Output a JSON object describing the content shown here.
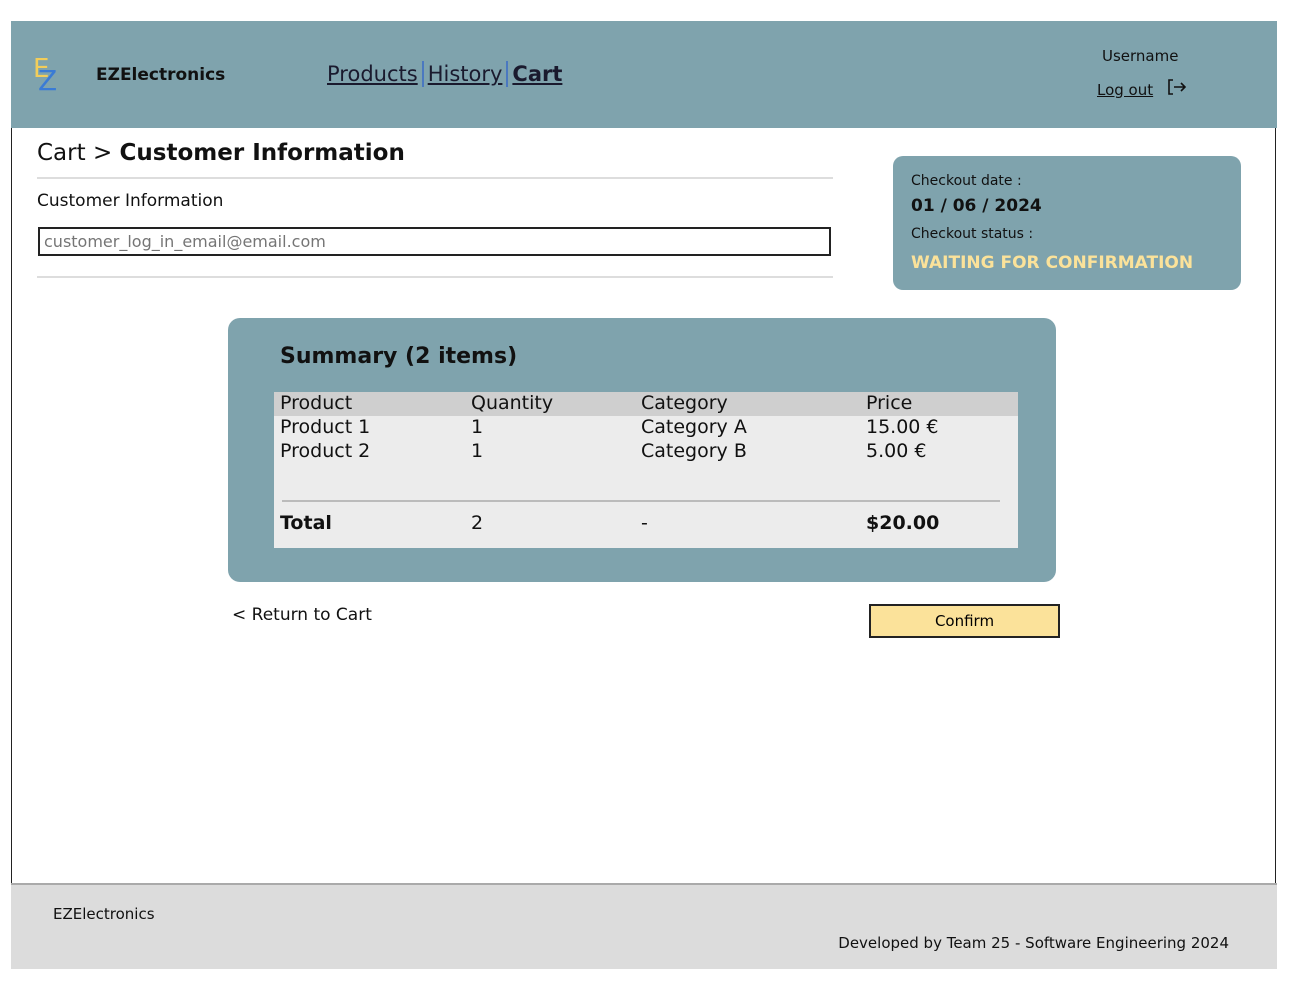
{
  "app": {
    "brand": "EZElectronics",
    "logo_letters": [
      "E",
      "Z"
    ]
  },
  "nav": {
    "products": "Products",
    "history": "History",
    "cart": "Cart"
  },
  "user": {
    "username": "Username",
    "logout": "Log out",
    "logout_icon": "logout-arrow-icon"
  },
  "breadcrumb": {
    "parent": "Cart",
    "separator": ">",
    "current": "Customer Information"
  },
  "customer": {
    "label": "Customer Information",
    "email_placeholder": "customer_log_in_email@email.com",
    "email_value": ""
  },
  "checkout": {
    "date_label": "Checkout date :",
    "date": "01 / 06 / 2024",
    "status_label": "Checkout status :",
    "status": "WAITING FOR CONFIRMATION"
  },
  "summary": {
    "title": "Summary (2 items)",
    "columns": [
      "Product",
      "Quantity",
      "Category",
      "Price"
    ],
    "rows": [
      [
        "Product 1",
        "1",
        "Category A",
        "15.00 €"
      ],
      [
        "Product 2",
        "1",
        "Category B",
        "5.00 €"
      ]
    ],
    "total": [
      "Total",
      "2",
      "-",
      "$20.00"
    ]
  },
  "actions": {
    "return": "< Return to Cart",
    "confirm": "Confirm"
  },
  "footer": {
    "brand": "EZElectronics",
    "credit": "Developed by Team 25 - Software Engineering 2024"
  },
  "colors": {
    "header": "#7fa3ad",
    "accent_yellow": "#fbe29a",
    "footer": "#dcdcdc",
    "logo_e": "#f2cd5a",
    "logo_z": "#3a7bd5"
  }
}
